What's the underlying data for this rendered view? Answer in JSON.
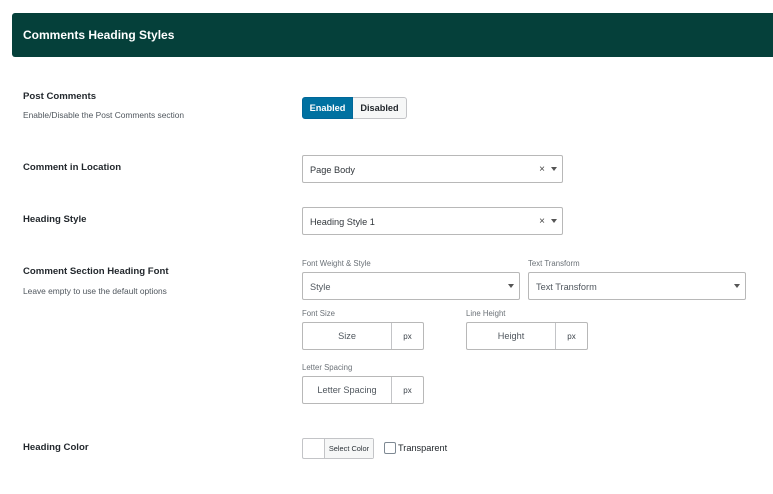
{
  "header": {
    "title": "Comments Heading Styles"
  },
  "post_comments": {
    "label": "Post Comments",
    "description": "Enable/Disable the Post Comments section",
    "enabled_label": "Enabled",
    "disabled_label": "Disabled",
    "active": "Enabled"
  },
  "comment_location": {
    "label": "Comment in Location",
    "value": "Page Body",
    "clear": "×"
  },
  "heading_style": {
    "label": "Heading Style",
    "value": "Heading Style 1",
    "clear": "×"
  },
  "heading_font": {
    "label": "Comment Section Heading Font",
    "description": "Leave empty to use the default options",
    "font_weight": {
      "label": "Font Weight & Style",
      "placeholder": "Style"
    },
    "text_transform": {
      "label": "Text Transform",
      "placeholder": "Text Transform"
    },
    "font_size": {
      "label": "Font Size",
      "placeholder": "Size",
      "unit": "px"
    },
    "line_height": {
      "label": "Line Height",
      "placeholder": "Height",
      "unit": "px"
    },
    "letter_spacing": {
      "label": "Letter Spacing",
      "placeholder": "Letter Spacing",
      "unit": "px"
    }
  },
  "heading_color": {
    "label": "Heading Color",
    "button_label": "Select Color",
    "transparent_label": "Transparent"
  },
  "colors": {
    "header_bg": "#05403a",
    "toggle_active": "#0071a1"
  }
}
